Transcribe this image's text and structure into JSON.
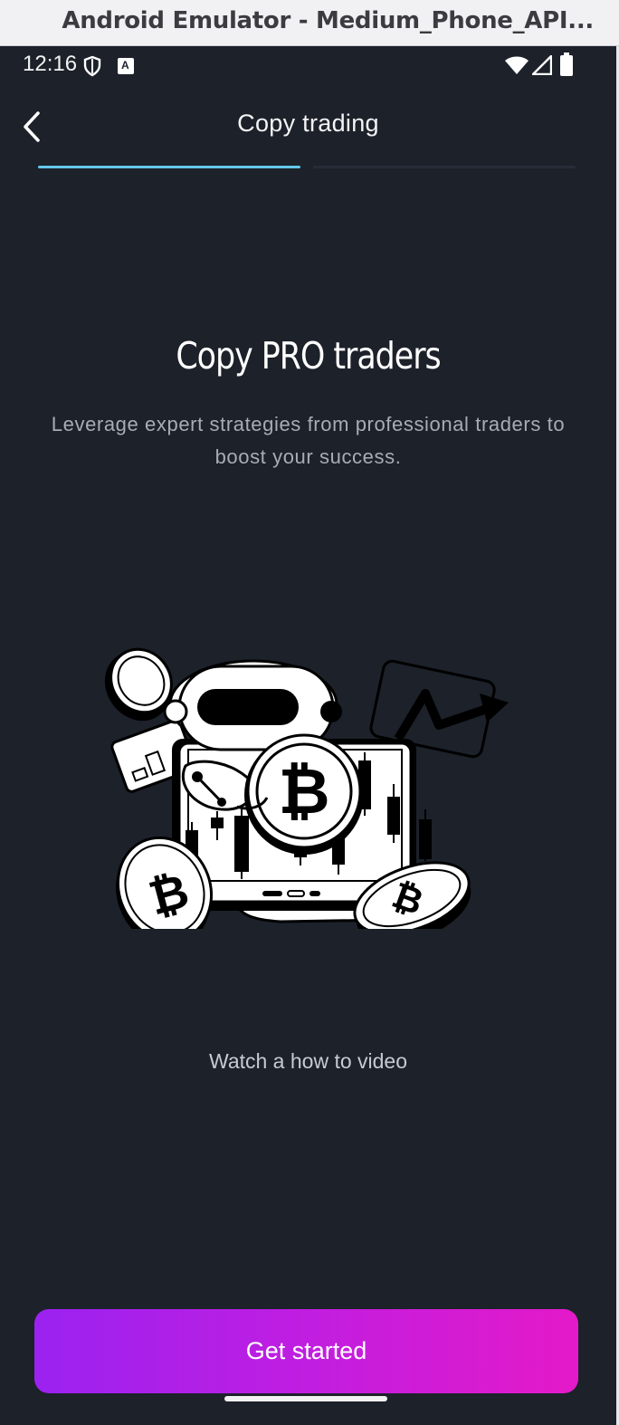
{
  "window": {
    "title": "Android Emulator - Medium_Phone_API..."
  },
  "status_bar": {
    "time": "12:16",
    "icons": [
      "shield-icon",
      "a-icon",
      "wifi-icon",
      "signal-icon",
      "battery-icon"
    ]
  },
  "header": {
    "title": "Copy trading",
    "back_icon": "chevron-left-icon",
    "steps_total": 2,
    "current_step": 1
  },
  "hero": {
    "title": "Copy PRO traders",
    "subtitle": "Leverage expert strategies from professional traders to boost your success.",
    "illustration": "robot-with-bitcoin-coins-illustration"
  },
  "video_link": "Watch a how to video",
  "cta": {
    "label": "Get started",
    "gradient_start": "#9b22f0",
    "gradient_end": "#e41ac8"
  },
  "colors": {
    "background": "#1c212a",
    "accent": "#63c7ec",
    "text_secondary": "#a7acb6"
  }
}
